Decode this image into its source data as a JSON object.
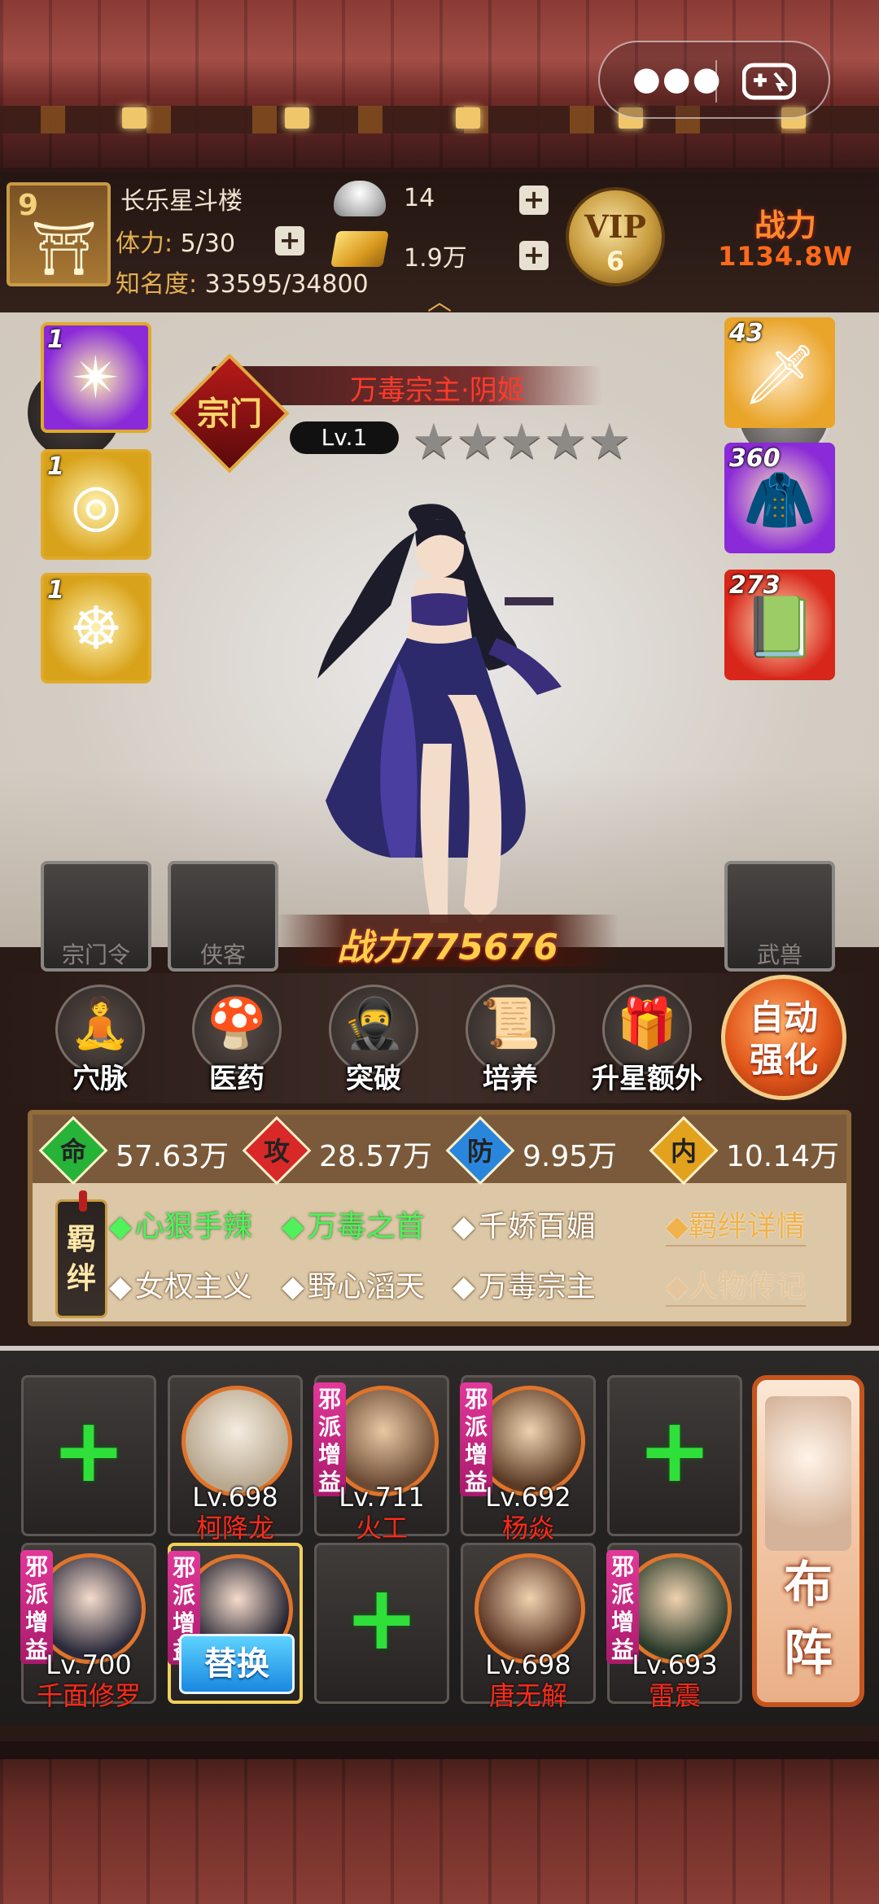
{
  "header": {
    "avatar_level": "9",
    "player_name": "长乐星斗楼",
    "stamina_label": "体力:",
    "stamina_value": "5/30",
    "fame_label": "知名度:",
    "fame_value": "33595/34800",
    "silver_count": "14",
    "gold_count": "1.9万",
    "vip_label": "VIP",
    "vip_level": "6",
    "power_label": "战力",
    "power_value": "1134.8W",
    "expand_icon": "chevron-up-icon"
  },
  "capsule": {
    "more_icon": "more-dots-icon",
    "gamepad_icon": "gamepad-icon"
  },
  "hero": {
    "sect_badge": "宗门",
    "name": "万毒宗主·阴姬",
    "level": "Lv.1",
    "stars_total": 5,
    "stars_filled": 0,
    "power": "战力775676",
    "skills": [
      {
        "level": "1",
        "icon": "shuriken-icon",
        "bg": "#8a2ad8"
      },
      {
        "level": "1",
        "icon": "swirl-icon",
        "bg": "#d8a21a"
      },
      {
        "level": "1",
        "icon": "meditation-icon",
        "bg": "#d8a21a"
      }
    ],
    "equipment": [
      {
        "level": "43",
        "icon": "dagger-icon",
        "bg": "#e9a42a"
      },
      {
        "level": "360",
        "icon": "cloak-icon",
        "bg": "#8a2ad8"
      },
      {
        "level": "273",
        "icon": "manual-book-icon",
        "bg": "#d8261a"
      }
    ],
    "empty_slots": {
      "sect_token": "宗门令",
      "companion": "侠客",
      "beast": "武兽"
    }
  },
  "functions": [
    {
      "label": "穴脉",
      "icon": "meridian-icon"
    },
    {
      "label": "医药",
      "icon": "herb-icon"
    },
    {
      "label": "突破",
      "icon": "breakthrough-icon"
    },
    {
      "label": "培养",
      "icon": "scroll-icon"
    },
    {
      "label": "升星额外",
      "icon": "treasure-icon"
    }
  ],
  "auto_strengthen": "自动强化",
  "stats": {
    "hp_label": "命",
    "hp_value": "57.63万",
    "atk_label": "攻",
    "atk_value": "28.57万",
    "def_label": "防",
    "def_value": "9.95万",
    "inner_label": "内",
    "inner_value": "10.14万"
  },
  "bonds": {
    "badge": "羁绊",
    "items": [
      {
        "text": "心狠手辣",
        "active": true
      },
      {
        "text": "万毒之首",
        "active": true
      },
      {
        "text": "千娇百媚",
        "active": false
      },
      {
        "text": "女权主义",
        "active": false
      },
      {
        "text": "野心滔天",
        "active": false
      },
      {
        "text": "万毒宗主",
        "active": false
      }
    ],
    "detail_link": "羁绊详情",
    "bio_link": "人物传记"
  },
  "team": {
    "row1": [
      {
        "empty": true
      },
      {
        "level": "Lv.698",
        "name": "柯降龙",
        "boost": false
      },
      {
        "level": "Lv.711",
        "name": "火工",
        "boost": true
      },
      {
        "level": "Lv.692",
        "name": "杨焱",
        "boost": true
      },
      {
        "empty": true
      }
    ],
    "row2": [
      {
        "level": "Lv.700",
        "name": "千面修罗",
        "boost": true
      },
      {
        "selected": true,
        "boost": true
      },
      {
        "empty": true
      },
      {
        "level": "Lv.698",
        "name": "唐无解",
        "boost": false
      },
      {
        "level": "Lv.693",
        "name": "雷震",
        "boost": true
      }
    ],
    "boost_label": "邪派增益",
    "replace_label": "替换",
    "formation_label": "布阵"
  },
  "colors": {
    "hp": "#27b338",
    "atk": "#d92828",
    "def": "#2a86dc",
    "inner": "#e3a21e"
  }
}
